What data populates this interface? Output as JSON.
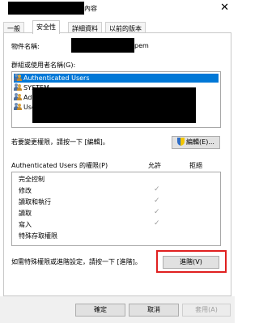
{
  "window": {
    "title_suffix": "內容",
    "close_glyph": "✕"
  },
  "tabs": [
    "一般",
    "安全性",
    "詳細資料",
    "以前的版本"
  ],
  "object_name": {
    "label": "物件名稱:",
    "value_suffix": "pem"
  },
  "groups": {
    "label": "群組或使用者名稱(G):",
    "items": [
      {
        "label": "Authenticated Users",
        "selected": true
      },
      {
        "label": "SYSTEM",
        "selected": false
      },
      {
        "label": "Admini",
        "selected": false
      },
      {
        "label": "Users (",
        "selected": false
      }
    ]
  },
  "edit_hint": "若要變更權限，請按一下 [編輯]。",
  "edit_button": "編輯(E)...",
  "permissions": {
    "header_label": "Authenticated Users 的權限(P)",
    "col_allow": "允許",
    "col_deny": "拒絕",
    "rows": [
      {
        "name": "完全控制",
        "allow": false
      },
      {
        "name": "修改",
        "allow": true
      },
      {
        "name": "讀取和執行",
        "allow": true
      },
      {
        "name": "讀取",
        "allow": true
      },
      {
        "name": "寫入",
        "allow": true
      },
      {
        "name": "特殊存取權限",
        "allow": false
      }
    ],
    "check_glyph": "✓"
  },
  "advanced_hint": "如需特殊權限或進階設定，請按一下 [進階]。",
  "advanced_button": "進階(V)",
  "buttons": {
    "ok": "確定",
    "cancel": "取消",
    "apply": "套用(A)"
  },
  "highlight_color": "#e02020",
  "selection_color": "#0078d7"
}
